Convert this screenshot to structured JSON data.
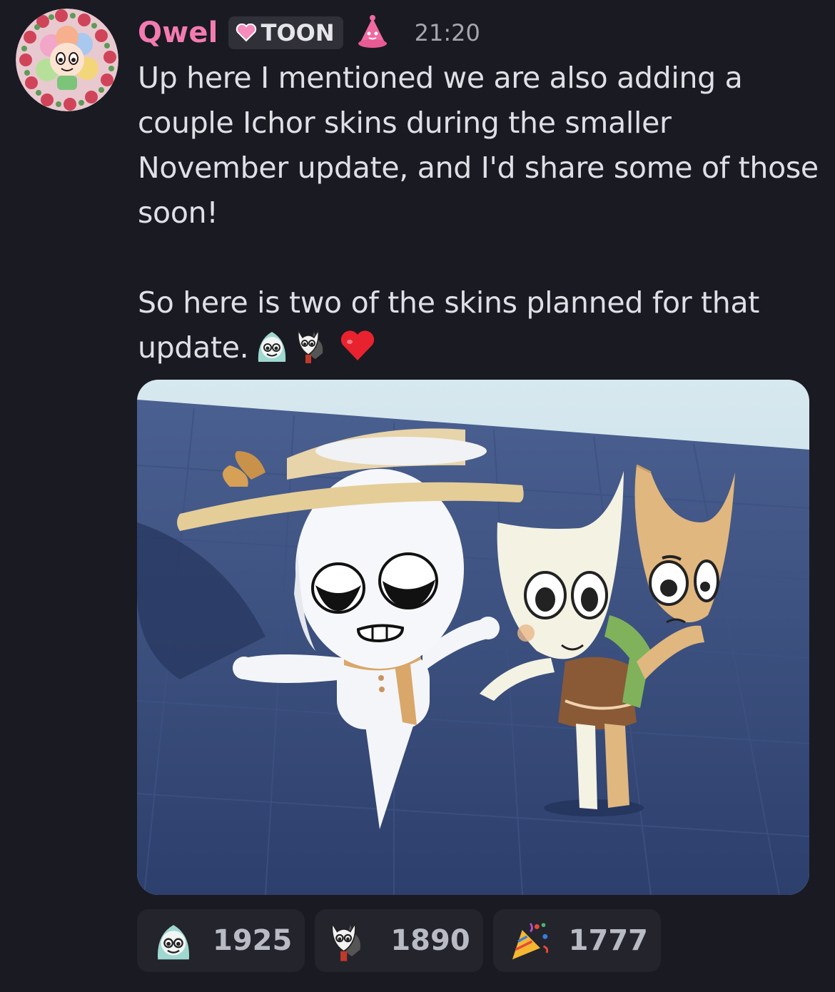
{
  "message": {
    "author": "Qwel",
    "author_color": "#f27bb0",
    "tag": {
      "icon": "pink-heart-icon",
      "label": "TOON"
    },
    "role_icon": "pink-bell-icon",
    "timestamp": "21:20",
    "paragraphs": [
      "Up here I mentioned we are also adding a couple Ichor skins during the smaller November update, and I'd share some of those soon!",
      "So here is two of the skins planned for that update."
    ],
    "inline_emojis": [
      "ghost-girl-emoji",
      "masks-emoji",
      "red-heart-emoji"
    ],
    "attachment": {
      "icon": "image-attachment"
    }
  },
  "reactions": [
    {
      "icon": "ghost-girl-emoji",
      "count": "1925"
    },
    {
      "icon": "masks-emoji",
      "count": "1890"
    },
    {
      "icon": "party-popper-emoji",
      "count": "1777"
    }
  ]
}
